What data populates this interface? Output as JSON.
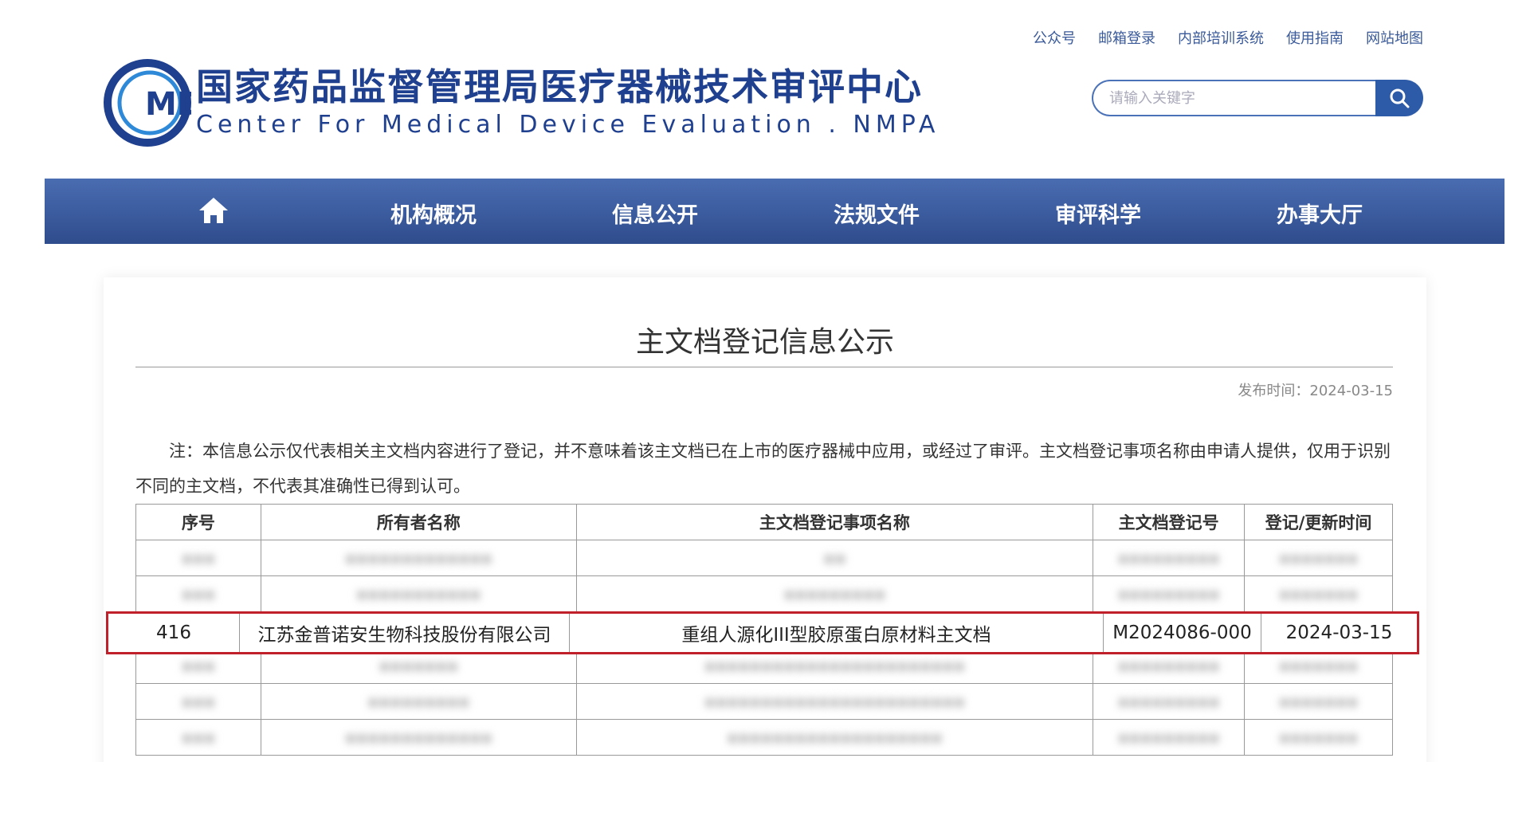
{
  "top_links": [
    "公众号",
    "邮箱登录",
    "内部培训系统",
    "使用指南",
    "网站地图"
  ],
  "logo": {
    "mark_text": "MDE",
    "cn": "国家药品监督管理局医疗器械技术审评中心",
    "en": "Center For Medical Device Evaluation . NMPA"
  },
  "search": {
    "placeholder": "请输入关键字"
  },
  "nav": [
    "机构概况",
    "信息公开",
    "法规文件",
    "审评科学",
    "办事大厅"
  ],
  "article": {
    "title": "主文档登记信息公示",
    "publish_time": "发布时间：2024-03-15",
    "note": "注：本信息公示仅代表相关主文档内容进行了登记，并不意味着该主文档已在上市的医疗器械中应用，或经过了审评。主文档登记事项名称由申请人提供，仅用于识别不同的主文档，不代表其准确性已得到认可。"
  },
  "table": {
    "headers": [
      "序号",
      "所有者名称",
      "主文档登记事项名称",
      "主文档登记号",
      "登记/更新时间"
    ],
    "highlight_row": [
      "416",
      "江苏金普诺安生物科技股份有限公司",
      "重组人源化III型胶原蛋白原材料主文档",
      "M2024086-000",
      "2024-03-15"
    ]
  },
  "colors": {
    "nav_bg": "#3c5da0",
    "brand": "#1f3f8f",
    "highlight_border": "#c0202a"
  }
}
